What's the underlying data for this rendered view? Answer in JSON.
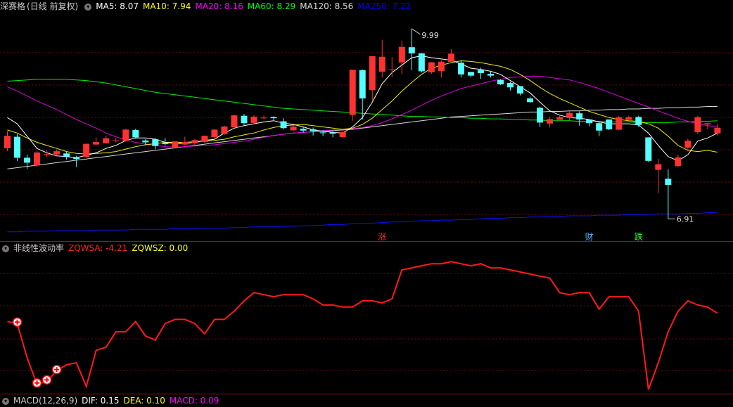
{
  "stock_header": {
    "name": "深赛格",
    "mode": "(日线 前复权)",
    "indicators": [
      {
        "label": "MA5:",
        "value": "8.07",
        "color": "#ffffff"
      },
      {
        "label": "MA10:",
        "value": "7.94",
        "color": "#ffff00"
      },
      {
        "label": "MA20:",
        "value": "8.16",
        "color": "#ff00ff"
      },
      {
        "label": "MA60:",
        "value": "8.29",
        "color": "#00ff00"
      },
      {
        "label": "MA120:",
        "value": "8.56",
        "color": "#dddddd"
      },
      {
        "label": "MA250:",
        "value": "7.22",
        "color": "#0000ff"
      }
    ]
  },
  "price_panel": {
    "high_label": "9.99",
    "low_label": "6.91",
    "markers": [
      {
        "text": "涨",
        "color": "#ff3030"
      },
      {
        "text": "财",
        "color": "#5ab4ff"
      },
      {
        "text": "跌",
        "color": "#30ff30"
      }
    ]
  },
  "indicator_header": {
    "name": "非线性波动率",
    "items": [
      {
        "label": "ZQWSA:",
        "value": "-4.21",
        "color": "#ff2020"
      },
      {
        "label": "ZQWSZ:",
        "value": "0.00",
        "color": "#ffff00"
      }
    ]
  },
  "bottom_header": {
    "name": "MACD(12,26,9)",
    "items": [
      {
        "label": "DIF:",
        "value": "0.15",
        "color": "#ffffff"
      },
      {
        "label": "DEA:",
        "value": "0.10",
        "color": "#ffff00"
      },
      {
        "label": "MACD:",
        "value": "0.09",
        "color": "#ff00ff"
      }
    ]
  },
  "candles": [
    [
      8.06,
      8.25,
      8.33,
      8.01
    ],
    [
      8.24,
      7.9,
      8.28,
      7.85
    ],
    [
      7.9,
      7.82,
      7.95,
      7.72
    ],
    [
      7.78,
      7.98,
      8.01,
      7.75
    ],
    [
      7.95,
      7.96,
      8.02,
      7.91
    ],
    [
      7.96,
      8.0,
      8.03,
      7.93
    ],
    [
      7.97,
      7.92,
      8.0,
      7.87
    ],
    [
      7.9,
      7.88,
      7.93,
      7.75
    ],
    [
      7.92,
      8.12,
      8.13,
      7.9
    ],
    [
      8.12,
      8.15,
      8.23,
      8.1
    ],
    [
      8.14,
      8.21,
      8.26,
      8.13
    ],
    [
      8.18,
      8.18,
      8.22,
      8.15
    ],
    [
      8.18,
      8.35,
      8.37,
      8.16
    ],
    [
      8.35,
      8.23,
      8.37,
      8.21
    ],
    [
      8.18,
      8.15,
      8.2,
      8.11
    ],
    [
      8.2,
      8.09,
      8.22,
      8.04
    ],
    [
      8.14,
      8.12,
      8.22,
      8.1
    ],
    [
      8.08,
      8.16,
      8.17,
      8.06
    ],
    [
      8.12,
      8.15,
      8.24,
      8.11
    ],
    [
      8.14,
      8.18,
      8.2,
      8.11
    ],
    [
      8.16,
      8.25,
      8.26,
      8.14
    ],
    [
      8.24,
      8.35,
      8.36,
      8.22
    ],
    [
      8.29,
      8.4,
      8.42,
      8.27
    ],
    [
      8.4,
      8.58,
      8.6,
      8.39
    ],
    [
      8.58,
      8.46,
      8.61,
      8.42
    ],
    [
      8.47,
      8.56,
      8.59,
      8.44
    ],
    [
      8.55,
      8.55,
      8.58,
      8.53
    ],
    [
      8.56,
      8.54,
      8.57,
      8.51
    ],
    [
      8.49,
      8.38,
      8.54,
      8.36
    ],
    [
      8.35,
      8.4,
      8.43,
      8.33
    ],
    [
      8.37,
      8.34,
      8.4,
      8.31
    ],
    [
      8.36,
      8.33,
      8.39,
      8.26
    ],
    [
      8.31,
      8.3,
      8.35,
      8.25
    ],
    [
      8.31,
      8.29,
      8.34,
      8.23
    ],
    [
      8.24,
      8.31,
      8.37,
      8.22
    ],
    [
      8.6,
      9.32,
      9.32,
      8.5
    ],
    [
      9.32,
      8.86,
      9.33,
      8.52
    ],
    [
      9.0,
      9.54,
      9.55,
      8.81
    ],
    [
      9.3,
      9.53,
      9.81,
      9.2
    ],
    [
      9.32,
      9.33,
      9.53,
      9.21
    ],
    [
      9.45,
      9.69,
      9.8,
      9.26
    ],
    [
      9.69,
      9.59,
      9.99,
      9.32
    ],
    [
      9.59,
      9.3,
      9.6,
      9.28
    ],
    [
      9.29,
      9.44,
      9.45,
      9.26
    ],
    [
      9.31,
      9.45,
      9.48,
      9.2
    ],
    [
      9.46,
      9.58,
      9.66,
      9.53
    ],
    [
      9.44,
      9.25,
      9.48,
      9.2
    ],
    [
      9.29,
      9.23,
      9.26,
      9.2
    ],
    [
      9.32,
      9.27,
      9.36,
      9.18
    ],
    [
      9.26,
      9.23,
      9.3,
      9.2
    ],
    [
      9.16,
      9.09,
      9.17,
      9.08
    ],
    [
      9.11,
      9.04,
      9.13,
      8.99
    ],
    [
      9.06,
      8.94,
      9.05,
      8.91
    ],
    [
      8.86,
      8.8,
      8.89,
      8.79
    ],
    [
      8.71,
      8.47,
      8.73,
      8.4
    ],
    [
      8.46,
      8.52,
      8.56,
      8.39
    ],
    [
      8.52,
      8.55,
      8.59,
      8.52
    ],
    [
      8.55,
      8.62,
      8.65,
      8.5
    ],
    [
      8.62,
      8.52,
      8.65,
      8.42
    ],
    [
      8.52,
      8.46,
      8.49,
      8.41
    ],
    [
      8.46,
      8.34,
      8.48,
      8.25
    ],
    [
      8.52,
      8.36,
      8.52,
      8.35
    ],
    [
      8.36,
      8.55,
      8.58,
      8.35
    ],
    [
      8.52,
      8.55,
      8.58,
      8.48
    ],
    [
      8.56,
      8.43,
      8.58,
      8.4
    ],
    [
      8.23,
      7.85,
      8.23,
      7.83
    ],
    [
      7.71,
      7.79,
      7.88,
      7.33
    ],
    [
      7.56,
      7.46,
      7.71,
      6.91
    ],
    [
      7.77,
      7.9,
      7.95,
      7.75
    ],
    [
      8.07,
      8.17,
      8.21,
      8.0
    ],
    [
      8.32,
      8.55,
      8.58,
      8.28
    ],
    [
      8.44,
      8.46,
      8.45,
      8.36
    ],
    [
      8.3,
      8.38,
      8.45,
      8.26
    ]
  ],
  "ma_lines": {
    "ma5": [
      8.55,
      8.45,
      8.25,
      8.05,
      7.98,
      7.93,
      7.92,
      7.9,
      7.94,
      7.98,
      8.05,
      8.1,
      8.18,
      8.22,
      8.22,
      8.2,
      8.15,
      8.13,
      8.13,
      8.15,
      8.18,
      8.2,
      8.3,
      8.38,
      8.42,
      8.45,
      8.48,
      8.5,
      8.46,
      8.44,
      8.4,
      8.35,
      8.33,
      8.31,
      8.3,
      8.4,
      8.55,
      8.8,
      9.1,
      9.28,
      9.4,
      9.52,
      9.55,
      9.52,
      9.5,
      9.48,
      9.42,
      9.35,
      9.33,
      9.3,
      9.25,
      9.15,
      9.05,
      8.95,
      8.8,
      8.66,
      8.59,
      8.55,
      8.54,
      8.52,
      8.48,
      8.45,
      8.45,
      8.45,
      8.43,
      8.3,
      8.1,
      7.92,
      7.85,
      7.95,
      8.17,
      8.22,
      8.3
    ],
    "ma10": [
      8.35,
      8.3,
      8.22,
      8.15,
      8.1,
      8.05,
      8.0,
      7.97,
      7.96,
      7.97,
      7.98,
      8.0,
      8.04,
      8.08,
      8.11,
      8.13,
      8.15,
      8.15,
      8.15,
      8.16,
      8.17,
      8.18,
      8.2,
      8.24,
      8.27,
      8.3,
      8.35,
      8.39,
      8.42,
      8.43,
      8.44,
      8.42,
      8.4,
      8.38,
      8.36,
      8.38,
      8.44,
      8.54,
      8.68,
      8.82,
      8.98,
      9.12,
      9.25,
      9.35,
      9.4,
      9.44,
      9.47,
      9.46,
      9.44,
      9.41,
      9.38,
      9.33,
      9.25,
      9.15,
      9.04,
      8.94,
      8.86,
      8.79,
      8.72,
      8.65,
      8.6,
      8.55,
      8.52,
      8.5,
      8.49,
      8.45,
      8.38,
      8.25,
      8.1,
      8.02,
      8.0,
      8.02,
      7.99
    ],
    "ma20": [
      9.05,
      8.98,
      8.9,
      8.82,
      8.75,
      8.68,
      8.6,
      8.52,
      8.45,
      8.38,
      8.3,
      8.24,
      8.19,
      8.15,
      8.12,
      8.1,
      8.08,
      8.07,
      8.08,
      8.09,
      8.1,
      8.11,
      8.13,
      8.15,
      8.17,
      8.2,
      8.23,
      8.26,
      8.28,
      8.3,
      8.31,
      8.32,
      8.34,
      8.35,
      8.36,
      8.37,
      8.39,
      8.42,
      8.47,
      8.53,
      8.6,
      8.67,
      8.75,
      8.83,
      8.9,
      8.96,
      9.02,
      9.06,
      9.1,
      9.14,
      9.17,
      9.2,
      9.21,
      9.22,
      9.22,
      9.2,
      9.18,
      9.16,
      9.12,
      9.07,
      9.02,
      8.96,
      8.9,
      8.84,
      8.78,
      8.72,
      8.66,
      8.6,
      8.54,
      8.49,
      8.45,
      8.42,
      8.4
    ],
    "ma60": [
      9.14,
      9.15,
      9.16,
      9.17,
      9.17,
      9.17,
      9.17,
      9.16,
      9.15,
      9.13,
      9.11,
      9.08,
      9.05,
      9.02,
      8.99,
      8.96,
      8.94,
      8.92,
      8.9,
      8.88,
      8.86,
      8.84,
      8.82,
      8.8,
      8.78,
      8.76,
      8.74,
      8.72,
      8.7,
      8.69,
      8.68,
      8.67,
      8.66,
      8.65,
      8.64,
      8.63,
      8.62,
      8.61,
      8.6,
      8.59,
      8.58,
      8.57,
      8.57,
      8.56,
      8.56,
      8.55,
      8.55,
      8.54,
      8.54,
      8.53,
      8.53,
      8.52,
      8.52,
      8.51,
      8.51,
      8.5,
      8.5,
      8.5,
      8.49,
      8.49,
      8.49,
      8.48,
      8.48,
      8.48,
      8.47,
      8.47,
      8.47,
      8.47,
      8.48,
      8.48,
      8.49,
      8.49,
      8.5
    ],
    "ma120": [
      7.72,
      7.74,
      7.76,
      7.78,
      7.8,
      7.82,
      7.84,
      7.86,
      7.88,
      7.9,
      7.92,
      7.94,
      7.96,
      7.98,
      8.0,
      8.02,
      8.04,
      8.06,
      8.08,
      8.1,
      8.12,
      8.14,
      8.16,
      8.18,
      8.2,
      8.22,
      8.24,
      8.26,
      8.28,
      8.3,
      8.31,
      8.32,
      8.33,
      8.34,
      8.35,
      8.36,
      8.38,
      8.4,
      8.42,
      8.44,
      8.46,
      8.48,
      8.5,
      8.52,
      8.54,
      8.56,
      8.57,
      8.58,
      8.59,
      8.6,
      8.61,
      8.62,
      8.63,
      8.64,
      8.64,
      8.65,
      8.65,
      8.66,
      8.66,
      8.67,
      8.67,
      8.68,
      8.68,
      8.69,
      8.69,
      8.7,
      8.7,
      8.71,
      8.71,
      8.72,
      8.72,
      8.73,
      8.73
    ],
    "ma250": [
      6.7,
      6.7,
      6.71,
      6.71,
      6.71,
      6.72,
      6.72,
      6.72,
      6.72,
      6.73,
      6.73,
      6.73,
      6.73,
      6.74,
      6.74,
      6.74,
      6.74,
      6.75,
      6.75,
      6.75,
      6.76,
      6.76,
      6.76,
      6.77,
      6.77,
      6.78,
      6.78,
      6.78,
      6.79,
      6.79,
      6.8,
      6.8,
      6.81,
      6.82,
      6.82,
      6.83,
      6.84,
      6.84,
      6.85,
      6.86,
      6.86,
      6.87,
      6.88,
      6.88,
      6.89,
      6.89,
      6.9,
      6.9,
      6.91,
      6.92,
      6.92,
      6.93,
      6.93,
      6.94,
      6.94,
      6.95,
      6.95,
      6.96,
      6.96,
      6.96,
      6.97,
      6.97,
      6.97,
      6.98,
      6.98,
      6.98,
      6.99,
      6.99,
      6.99,
      7.0,
      7.0,
      7.01,
      7.01
    ]
  },
  "zqwsa": [
    -30,
    -32,
    -65,
    -91,
    -88,
    -78,
    -72,
    -70,
    -93,
    -58,
    -55,
    -40,
    -40,
    -30,
    -44,
    -48,
    -32,
    -28,
    -28,
    -32,
    -42,
    -28,
    -28,
    -20,
    -10,
    -2,
    -4,
    -6,
    -4,
    -4,
    -4,
    -8,
    -14,
    -14,
    -16,
    -16,
    -10,
    -10,
    -12,
    -8,
    20,
    22,
    24,
    26,
    26,
    28,
    26,
    24,
    26,
    22,
    22,
    20,
    18,
    16,
    14,
    12,
    -2,
    -4,
    -2,
    -2,
    -18,
    -6,
    -6,
    -6,
    -20,
    -96,
    -70,
    -40,
    -20,
    -10,
    -14,
    -16,
    -22
  ],
  "buy_signal_indices": [
    1,
    3,
    4,
    5
  ]
}
